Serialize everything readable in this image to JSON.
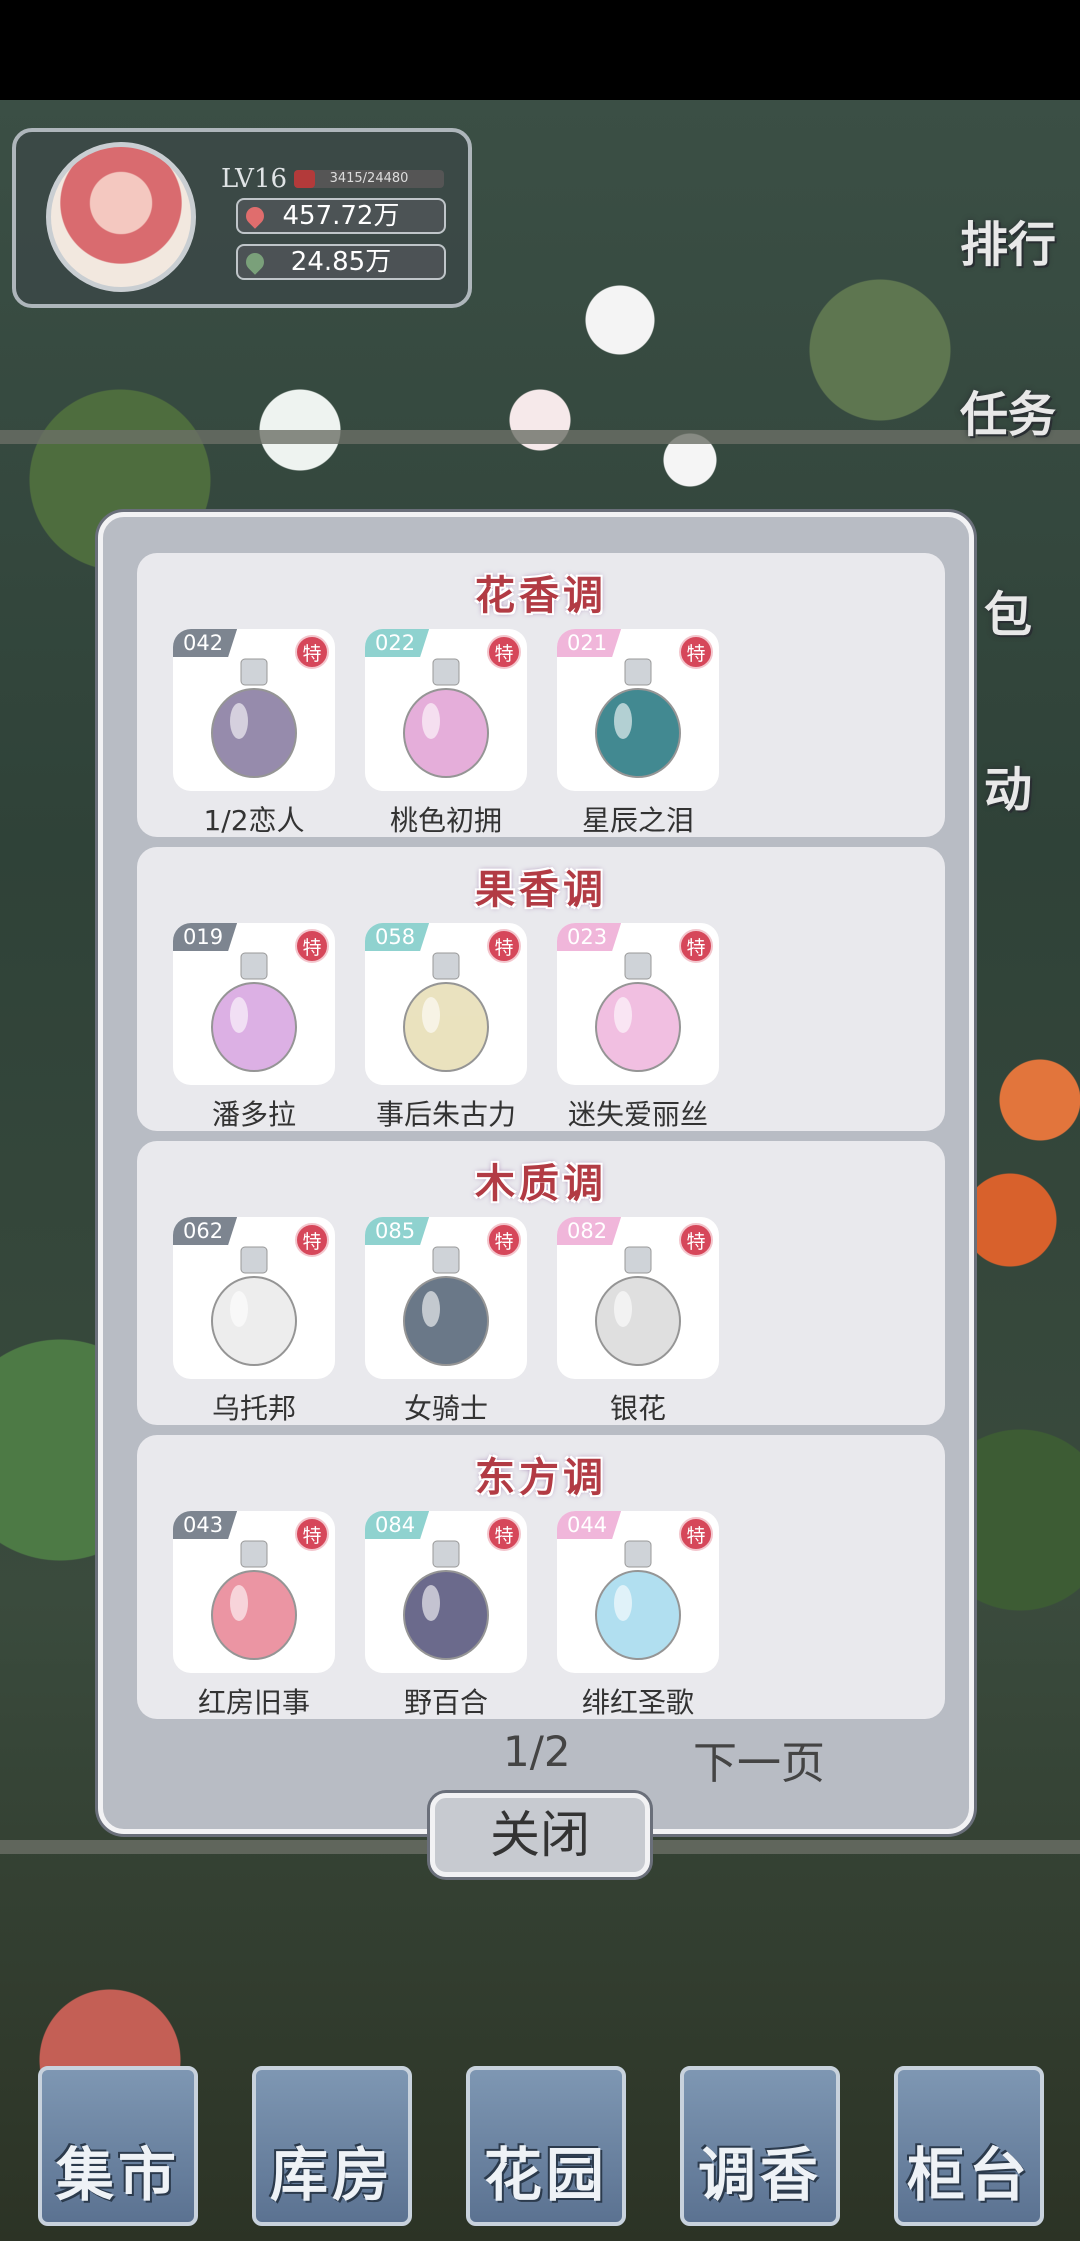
{
  "player": {
    "level": "LV16",
    "exp_text": "3415/24480",
    "exp_fraction": 0.1395,
    "gold": "457.72万",
    "leaf": "24.85万"
  },
  "side_menu": {
    "rank": "排行",
    "task": "任务",
    "bag": "包",
    "event": "动"
  },
  "sections": [
    {
      "title": "花香调",
      "items": [
        {
          "num": "042",
          "badge": "特",
          "name": "1/2恋人",
          "bottle_color": "#8b7fa3"
        },
        {
          "num": "022",
          "badge": "特",
          "name": "桃色初拥",
          "bottle_color": "#e3a6d6"
        },
        {
          "num": "021",
          "badge": "特",
          "name": "星辰之泪",
          "bottle_color": "#2e7d86"
        }
      ]
    },
    {
      "title": "果香调",
      "items": [
        {
          "num": "019",
          "badge": "特",
          "name": "潘多拉",
          "bottle_color": "#d9a8e2"
        },
        {
          "num": "058",
          "badge": "特",
          "name": "事后朱古力",
          "bottle_color": "#e8dfb8"
        },
        {
          "num": "023",
          "badge": "特",
          "name": "迷失爱丽丝",
          "bottle_color": "#f0b8de"
        }
      ]
    },
    {
      "title": "木质调",
      "items": [
        {
          "num": "062",
          "badge": "特",
          "name": "乌托邦",
          "bottle_color": "#ececec"
        },
        {
          "num": "085",
          "badge": "特",
          "name": "女骑士",
          "bottle_color": "#5a6a7c"
        },
        {
          "num": "082",
          "badge": "特",
          "name": "银花",
          "bottle_color": "#dcdcdc"
        }
      ]
    },
    {
      "title": "东方调",
      "items": [
        {
          "num": "043",
          "badge": "特",
          "name": "红房旧事",
          "bottle_color": "#e98a9a"
        },
        {
          "num": "084",
          "badge": "特",
          "name": "野百合",
          "bottle_color": "#5b5a80"
        },
        {
          "num": "044",
          "badge": "特",
          "name": "绯红圣歌",
          "bottle_color": "#a9dcef"
        }
      ]
    }
  ],
  "pager": {
    "page": "1/2",
    "next": "下一页"
  },
  "close_label": "关闭",
  "bottom_nav": [
    "集市",
    "库房",
    "花园",
    "调香",
    "柜台"
  ]
}
